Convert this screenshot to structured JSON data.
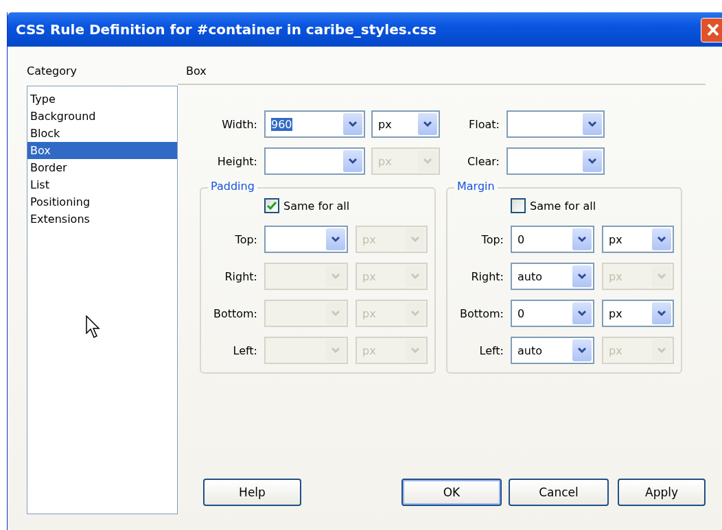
{
  "window": {
    "title": "CSS Rule Definition for #container in caribe_styles.css"
  },
  "category": {
    "label": "Category",
    "items": [
      {
        "label": "Type",
        "selected": false
      },
      {
        "label": "Background",
        "selected": false
      },
      {
        "label": "Block",
        "selected": false
      },
      {
        "label": "Box",
        "selected": true
      },
      {
        "label": "Border",
        "selected": false
      },
      {
        "label": "List",
        "selected": false
      },
      {
        "label": "Positioning",
        "selected": false
      },
      {
        "label": "Extensions",
        "selected": false
      }
    ]
  },
  "panel": {
    "title": "Box"
  },
  "top_rows": [
    {
      "label": "Width:",
      "value": {
        "text": "960",
        "highlighted": true,
        "disabled": false
      },
      "unit": {
        "text": "px",
        "disabled": false
      },
      "side_label": "Float:",
      "side": {
        "disabled": false
      }
    },
    {
      "label": "Height:",
      "value": {
        "disabled": false
      },
      "unit": {
        "text": "px",
        "disabled": true
      },
      "side_label": "Clear:",
      "side": {
        "disabled": false
      }
    }
  ],
  "groups": [
    {
      "legend": "Padding",
      "same_for_all": {
        "label": "Same for all",
        "checked": true
      },
      "rows": [
        {
          "label": "Top:",
          "value": {
            "disabled": false
          },
          "unit": {
            "text": "px",
            "disabled": true
          }
        },
        {
          "label": "Right:",
          "value": {
            "disabled": true
          },
          "unit": {
            "text": "px",
            "disabled": true
          }
        },
        {
          "label": "Bottom:",
          "value": {
            "disabled": true
          },
          "unit": {
            "text": "px",
            "disabled": true
          }
        },
        {
          "label": "Left:",
          "value": {
            "disabled": true
          },
          "unit": {
            "text": "px",
            "disabled": true
          }
        }
      ]
    },
    {
      "legend": "Margin",
      "same_for_all": {
        "label": "Same for all",
        "checked": false
      },
      "rows": [
        {
          "label": "Top:",
          "value": {
            "text": "0",
            "disabled": false
          },
          "unit": {
            "text": "px",
            "disabled": false
          }
        },
        {
          "label": "Right:",
          "value": {
            "text": "auto",
            "disabled": false
          },
          "unit": {
            "text": "px",
            "disabled": true
          }
        },
        {
          "label": "Bottom:",
          "value": {
            "text": "0",
            "disabled": false
          },
          "unit": {
            "text": "px",
            "disabled": false
          }
        },
        {
          "label": "Left:",
          "value": {
            "text": "auto",
            "disabled": false
          },
          "unit": {
            "text": "px",
            "disabled": true
          }
        }
      ]
    }
  ],
  "buttons": [
    {
      "label": "Help",
      "default": false
    },
    {
      "label": "OK",
      "default": true
    },
    {
      "label": "Cancel",
      "default": false
    },
    {
      "label": "Apply",
      "default": false
    }
  ]
}
